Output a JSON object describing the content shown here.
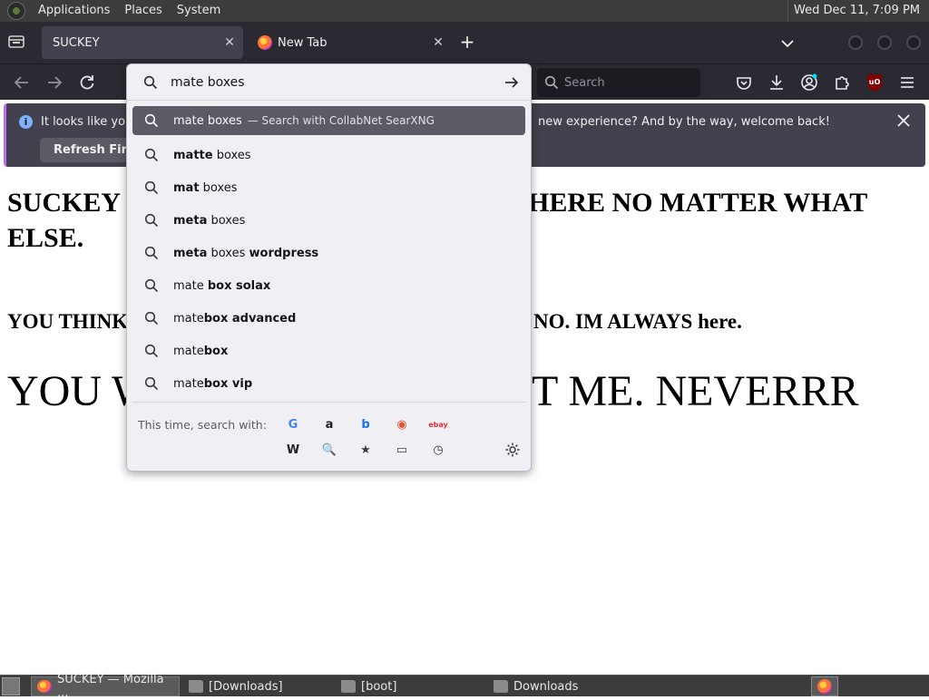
{
  "top_panel": {
    "menus": [
      "Applications",
      "Places",
      "System"
    ],
    "clock": "Wed Dec 11,  7:09 PM"
  },
  "tabs": [
    {
      "title": "SUCKEY",
      "active": true
    },
    {
      "title": "New Tab",
      "active": false
    }
  ],
  "navbar": {
    "search_placeholder": "Search"
  },
  "notification": {
    "message_left": "It looks like you l",
    "message_right": "new experience? And by the way, welcome back!",
    "button_label": "Refresh Firefox"
  },
  "urlbar": {
    "value": "mate boxes",
    "selected": {
      "text": "mate boxes",
      "action": "—  Search with CollabNet SearXNG"
    },
    "suggestions": [
      {
        "plain_pre": "",
        "bold": "matte",
        "plain_post": " boxes"
      },
      {
        "plain_pre": "",
        "bold": "mat",
        "plain_post": " boxes"
      },
      {
        "plain_pre": "",
        "bold": "meta",
        "plain_post": " boxes"
      },
      {
        "plain_pre": "",
        "bold": "meta",
        "plain_post": " boxes ",
        "bold2": "wordpress"
      },
      {
        "plain_pre": "mate ",
        "bold": "box solax",
        "plain_post": ""
      },
      {
        "plain_pre": "mate",
        "bold": "box advanced",
        "plain_post": ""
      },
      {
        "plain_pre": "mate",
        "bold": "box",
        "plain_post": ""
      },
      {
        "plain_pre": "mate",
        "bold": "box vip",
        "plain_post": ""
      }
    ],
    "oneoff_label": "This time, search with:",
    "engines": [
      {
        "name": "google-icon",
        "glyph": "G",
        "color": "#4285f4"
      },
      {
        "name": "amazon-icon",
        "glyph": "a",
        "color": "#222222"
      },
      {
        "name": "bing-icon",
        "glyph": "b",
        "color": "#1a73e8"
      },
      {
        "name": "duckduckgo-icon",
        "glyph": "◉",
        "color": "#de5833"
      },
      {
        "name": "ebay-icon",
        "glyph": "ebay",
        "color": "#e53238"
      },
      {
        "name": "wikipedia-icon",
        "glyph": "W",
        "color": "#222222"
      },
      {
        "name": "searxng-icon",
        "glyph": "🔍",
        "color": "#888888"
      },
      {
        "name": "bookmarks-icon",
        "glyph": "★",
        "color": "#3a3944"
      },
      {
        "name": "tabs-icon",
        "glyph": "▭",
        "color": "#3a3944"
      },
      {
        "name": "history-icon",
        "glyph": "◷",
        "color": "#3a3944"
      }
    ]
  },
  "page": {
    "h1": "SUCKEY IS HERE. SUCKEY IS STILL HERE NO MATTER WHAT ELSE.",
    "h1_left": "SUCKEY",
    "h1_right": "HERE NO MATTER WHAT",
    "h1_line2": "ELSE.",
    "h2_left": "YOU THINK",
    "h2_right": "NO. IM ALWAYS here.",
    "big_left": "YOU W",
    "big_right": "T ME. NEVERRR"
  },
  "taskbar": {
    "items": [
      {
        "label": "SUCKEY — Mozilla ...",
        "active": true
      },
      {
        "label": "[Downloads]",
        "active": false
      },
      {
        "label": "[boot]",
        "active": false
      },
      {
        "label": "Downloads",
        "active": false
      }
    ]
  }
}
